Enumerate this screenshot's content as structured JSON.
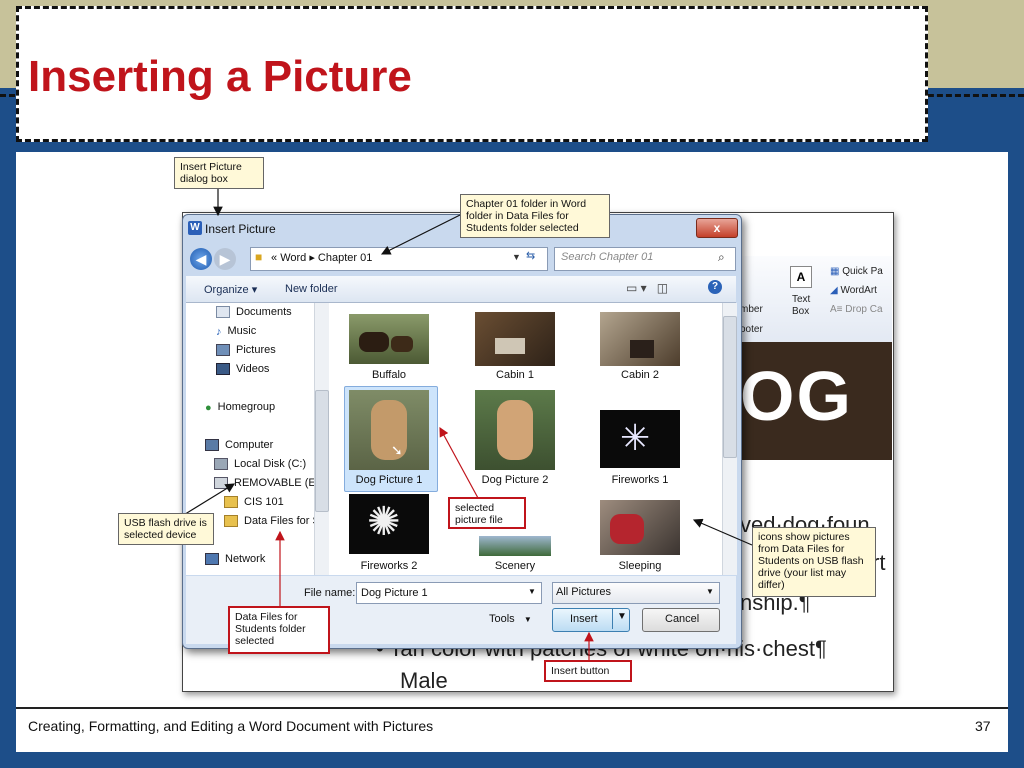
{
  "slide": {
    "title": "Inserting a Picture",
    "footer": "Creating, Formatting, and Editing a Word Document with Pictures",
    "page_number": "37"
  },
  "word_doc": {
    "ribbon": {
      "quick_parts": "Quick Pa",
      "wordart": "WordArt",
      "drop_cap": "Drop Ca",
      "text_box": "Text",
      "text_box2": "Box",
      "number": "mber",
      "footer": "ooter"
    },
    "banner_text": "OG",
    "lines": [
      "ved·dog·foun",
      "rt",
      "nship.¶",
      "• Tan color with patches of white on·his·chest¶",
      "Male"
    ]
  },
  "dialog": {
    "title": "Insert Picture",
    "close_label": "x",
    "address": {
      "prefix": "«",
      "path": [
        "Word",
        "Chapter 01"
      ]
    },
    "search_placeholder": "Search Chapter 01",
    "toolbar": {
      "organize": "Organize ▾",
      "new_folder": "New folder"
    },
    "nav_items": [
      {
        "label": "Documents",
        "icon": "documents-icon"
      },
      {
        "label": "Music",
        "icon": "music-icon"
      },
      {
        "label": "Pictures",
        "icon": "pictures-icon"
      },
      {
        "label": "Videos",
        "icon": "videos-icon"
      },
      {
        "label": "Homegroup",
        "icon": "homegroup-icon"
      },
      {
        "label": "Computer",
        "icon": "computer-icon"
      },
      {
        "label": "Local Disk (C:)",
        "icon": "disk-icon"
      },
      {
        "label": "REMOVABLE (E:)",
        "icon": "usb-drive-icon"
      },
      {
        "label": "CIS 101",
        "icon": "folder-icon"
      },
      {
        "label": "Data Files for St",
        "icon": "folder-icon"
      },
      {
        "label": "Network",
        "icon": "network-icon"
      }
    ],
    "files": [
      {
        "label": "Buffalo"
      },
      {
        "label": "Cabin 1"
      },
      {
        "label": "Cabin 2"
      },
      {
        "label": "Dog Picture 1"
      },
      {
        "label": "Dog Picture 2"
      },
      {
        "label": "Fireworks 1"
      },
      {
        "label": "Fireworks 2"
      },
      {
        "label": "Scenery"
      },
      {
        "label": "Sleeping"
      }
    ],
    "selected_file": "Dog Picture 1",
    "file_name_label": "File name:",
    "file_name_value": "Dog Picture 1",
    "file_type_value": "All Pictures",
    "tools_label": "Tools",
    "insert_label": "Insert",
    "cancel_label": "Cancel"
  },
  "callouts": {
    "insert_picture": "Insert Picture dialog box",
    "chapter_folder": "Chapter 01 folder in Word folder in Data Files for Students folder selected",
    "usb": "USB flash drive is selected device",
    "selected_file": "selected picture file",
    "icons": "icons show pictures from Data Files for Students on USB flash drive (your list may differ)",
    "data_files": "Data Files for Students folder selected",
    "insert_button": "Insert button"
  },
  "colors": {
    "title_red": "#c0141b",
    "slide_blue": "#1d4e89",
    "top_band": "#c7c29a"
  }
}
